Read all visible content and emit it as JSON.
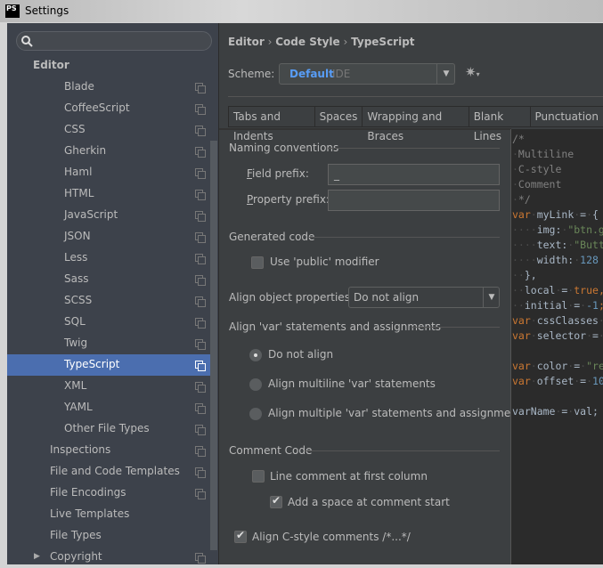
{
  "window": {
    "title": "Settings",
    "logo": "PS"
  },
  "sidebar": {
    "search_placeholder": "",
    "items": [
      {
        "label": "Editor",
        "level": 0,
        "icon": false
      },
      {
        "label": "Blade",
        "level": 2,
        "icon": true
      },
      {
        "label": "CoffeeScript",
        "level": 2,
        "icon": true
      },
      {
        "label": "CSS",
        "level": 2,
        "icon": true
      },
      {
        "label": "Gherkin",
        "level": 2,
        "icon": true
      },
      {
        "label": "Haml",
        "level": 2,
        "icon": true
      },
      {
        "label": "HTML",
        "level": 2,
        "icon": true
      },
      {
        "label": "JavaScript",
        "level": 2,
        "icon": true
      },
      {
        "label": "JSON",
        "level": 2,
        "icon": true
      },
      {
        "label": "Less",
        "level": 2,
        "icon": true
      },
      {
        "label": "Sass",
        "level": 2,
        "icon": true
      },
      {
        "label": "SCSS",
        "level": 2,
        "icon": true
      },
      {
        "label": "SQL",
        "level": 2,
        "icon": true
      },
      {
        "label": "Twig",
        "level": 2,
        "icon": true
      },
      {
        "label": "TypeScript",
        "level": 2,
        "icon": true,
        "selected": true
      },
      {
        "label": "XML",
        "level": 2,
        "icon": true
      },
      {
        "label": "YAML",
        "level": 2,
        "icon": true
      },
      {
        "label": "Other File Types",
        "level": 2,
        "icon": true
      },
      {
        "label": "Inspections",
        "level": 1,
        "icon": true
      },
      {
        "label": "File and Code Templates",
        "level": 1,
        "icon": true
      },
      {
        "label": "File Encodings",
        "level": 1,
        "icon": true
      },
      {
        "label": "Live Templates",
        "level": 1,
        "icon": false
      },
      {
        "label": "File Types",
        "level": 1,
        "icon": false
      },
      {
        "label": "Copyright",
        "level": 1,
        "icon": true,
        "expandable": true
      }
    ]
  },
  "breadcrumb": [
    "Editor",
    "Code Style",
    "TypeScript"
  ],
  "scheme": {
    "label": "Scheme:",
    "value": "Default",
    "suffix": "IDE"
  },
  "tabs": [
    "Tabs and Indents",
    "Spaces",
    "Wrapping and Braces",
    "Blank Lines",
    "Punctuation"
  ],
  "naming": {
    "title": "Naming conventions",
    "field_prefix_label": "Field prefix:",
    "field_prefix_value": "_",
    "property_prefix_label": "Property prefix:",
    "property_prefix_value": ""
  },
  "generated": {
    "title": "Generated code",
    "use_public": "Use 'public' modifier",
    "use_public_checked": false
  },
  "align_obj": {
    "label": "Align object properties:",
    "value": "Do not align"
  },
  "align_var": {
    "title": "Align 'var' statements and assignments",
    "options": [
      "Do not align",
      "Align multiline 'var' statements",
      "Align multiple 'var' statements and assignments"
    ],
    "selected": 0
  },
  "comment": {
    "title": "Comment Code",
    "line_first": "Line comment at first column",
    "line_first_checked": false,
    "add_space": "Add a space at comment start",
    "add_space_checked": true
  },
  "align_c": {
    "label": "Align C-style comments /*...*/",
    "checked": true
  },
  "colors": {
    "selection": "#4b6eaf",
    "keyword": "#cc7832",
    "string": "#6a8759",
    "number": "#6897bb"
  },
  "code": [
    [
      [
        "/*",
        "cm"
      ]
    ],
    [
      [
        " Multiline",
        "cm"
      ]
    ],
    [
      [
        " C-style",
        "cm"
      ]
    ],
    [
      [
        " Comment",
        "cm"
      ]
    ],
    [
      [
        " */",
        "cm"
      ]
    ],
    [
      [
        "var",
        "kw"
      ],
      [
        " myLink = {",
        "pl"
      ]
    ],
    [
      [
        "    img: ",
        "pl"
      ],
      [
        "\"btn.g",
        "str"
      ]
    ],
    [
      [
        "    text: ",
        "pl"
      ],
      [
        "\"Butt",
        "str"
      ]
    ],
    [
      [
        "    width: ",
        "pl"
      ],
      [
        "128",
        "num"
      ]
    ],
    [
      [
        "  },",
        "pl"
      ]
    ],
    [
      [
        "  local = ",
        "pl"
      ],
      [
        "true,",
        "kw"
      ]
    ],
    [
      [
        "  initial = ",
        "pl"
      ],
      [
        "-1",
        "num"
      ],
      [
        ";",
        "kw"
      ]
    ],
    [
      [
        "var",
        "kw"
      ],
      [
        " cssClasses ",
        "pl"
      ]
    ],
    [
      [
        "var",
        "kw"
      ],
      [
        " selector = ",
        "pl"
      ]
    ],
    [],
    [
      [
        "var",
        "kw"
      ],
      [
        " color = ",
        "pl"
      ],
      [
        "\"re",
        "str"
      ]
    ],
    [
      [
        "var",
        "kw"
      ],
      [
        " offset = ",
        "pl"
      ],
      [
        "10",
        "num"
      ]
    ],
    [],
    [
      [
        "varName = val;",
        "pl"
      ]
    ]
  ]
}
